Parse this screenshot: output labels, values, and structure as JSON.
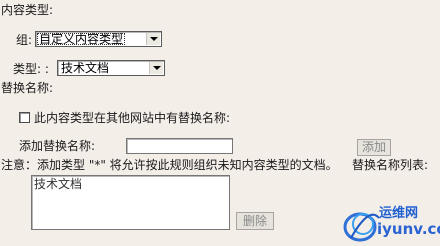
{
  "content_type_heading": "内容类型:",
  "group": {
    "label": "组:",
    "selected": "自定义内容类型"
  },
  "type": {
    "label": "类型: :",
    "selected": "技术文档"
  },
  "alt_names_heading": "替换名称:",
  "other_site_checkbox": {
    "label": "此内容类型在其他网站中有替换名称:",
    "checked": false
  },
  "add_alt_name": {
    "label": "添加替换名称:",
    "value": "",
    "button": "添加"
  },
  "note": "注意：添加类型 \"*\" 将允许按此规则组织未知内容类型的文档。",
  "alt_list": {
    "label": "替换名称列表:",
    "items": [
      "技术文档"
    ],
    "delete_button": "删除"
  },
  "watermark": {
    "cn": "运维网",
    "url": "iyunv.com"
  }
}
